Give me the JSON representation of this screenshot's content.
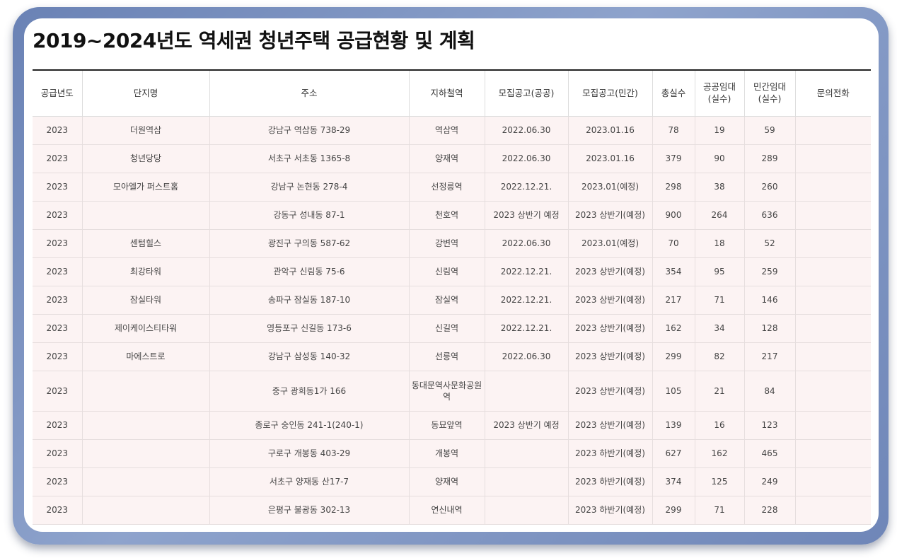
{
  "title": "2019~2024년도 역세권 청년주택 공급현황 및 계획",
  "columns": [
    "공급년도",
    "단지명",
    "주소",
    "지하철역",
    "모집공고(공공)",
    "모집공고(민간)",
    "총실수",
    "공공임대\n(실수)",
    "민간임대\n(실수)",
    "문의전화"
  ],
  "rows": [
    [
      "2023",
      "더원역삼",
      "강남구 역삼동 738-29",
      "역삼역",
      "2022.06.30",
      "2023.01.16",
      "78",
      "19",
      "59",
      ""
    ],
    [
      "2023",
      "청년당당",
      "서초구 서초동 1365-8",
      "양재역",
      "2022.06.30",
      "2023.01.16",
      "379",
      "90",
      "289",
      ""
    ],
    [
      "2023",
      "모아엘가 퍼스트홈",
      "강남구 논현동 278-4",
      "선정릉역",
      "2022.12.21.",
      "2023.01(예정)",
      "298",
      "38",
      "260",
      ""
    ],
    [
      "2023",
      "",
      "강동구 성내동 87-1",
      "천호역",
      "2023 상반기 예정",
      "2023 상반기(예정)",
      "900",
      "264",
      "636",
      ""
    ],
    [
      "2023",
      "센텀힐스",
      "광진구 구의동 587-62",
      "강변역",
      "2022.06.30",
      "2023.01(예정)",
      "70",
      "18",
      "52",
      ""
    ],
    [
      "2023",
      "최강타워",
      "관악구 신림동 75-6",
      "신림역",
      "2022.12.21.",
      "2023 상반기(예정)",
      "354",
      "95",
      "259",
      ""
    ],
    [
      "2023",
      "잠실타워",
      "송파구 잠실동 187-10",
      "잠실역",
      "2022.12.21.",
      "2023 상반기(예정)",
      "217",
      "71",
      "146",
      ""
    ],
    [
      "2023",
      "제이케이스티타워",
      "영등포구 신길동 173-6",
      "신길역",
      "2022.12.21.",
      "2023 상반기(예정)",
      "162",
      "34",
      "128",
      ""
    ],
    [
      "2023",
      "마에스트로",
      "강남구 삼성동 140-32",
      "선릉역",
      "2022.06.30",
      "2023 상반기(예정)",
      "299",
      "82",
      "217",
      ""
    ],
    [
      "2023",
      "",
      "중구 광희동1가 166",
      "동대문역사문화공원역",
      "",
      "2023 상반기(예정)",
      "105",
      "21",
      "84",
      ""
    ],
    [
      "2023",
      "",
      "종로구 숭인동 241-1(240-1)",
      "동묘앞역",
      "2023 상반기 예정",
      "2023 상반기(예정)",
      "139",
      "16",
      "123",
      ""
    ],
    [
      "2023",
      "",
      "구로구 개봉동 403-29",
      "개봉역",
      "",
      "2023 하반기(예정)",
      "627",
      "162",
      "465",
      ""
    ],
    [
      "2023",
      "",
      "서초구 양재동 산17-7",
      "양재역",
      "",
      "2023 하반기(예정)",
      "374",
      "125",
      "249",
      ""
    ],
    [
      "2023",
      "",
      "은평구 불광동 302-13",
      "연신내역",
      "",
      "2023 하반기(예정)",
      "299",
      "71",
      "228",
      ""
    ]
  ]
}
